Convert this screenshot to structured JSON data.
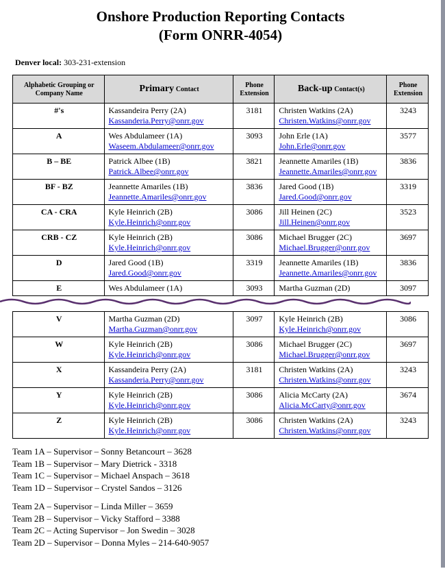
{
  "title_line1": "Onshore Production Reporting Contacts",
  "title_line2": "(Form ONRR-4054)",
  "denver_label": "Denver local:",
  "denver_value": "303-231-extension",
  "headers": {
    "group": "Alphabetic Grouping or Company Name",
    "company_word": "Company",
    "primary_big": "Primary",
    "primary_small": "Contact",
    "ext": "Phone Extension",
    "backup_big": "Back-up",
    "backup_small": "Contact(s)",
    "ext2": "Phone Extension"
  },
  "rows_top": [
    {
      "g": "#'s",
      "p_name": "Kassandeira Perry (2A)",
      "p_mail": "Kassanderia.Perry@onrr.gov",
      "p_ext": "3181",
      "b_name": "Christen Watkins (2A)",
      "b_mail": "Christen.Watkins@onrr.gov",
      "b_ext": "3243"
    },
    {
      "g": "A",
      "p_name": "Wes Abdulameer (1A)",
      "p_mail": "Waseem.Abdulameer@onrr.gov",
      "p_ext": "3093",
      "b_name": "John Erle (1A)",
      "b_mail": "John.Erle@onrr.gov",
      "b_ext": "3577"
    },
    {
      "g": "B – BE",
      "p_name": "Patrick Albee (1B)",
      "p_mail": "Patrick.Albee@onrr.gov",
      "p_ext": "3821",
      "b_name": "Jeannette Amariles (1B)",
      "b_mail": "Jeannette.Amariles@onrr.gov",
      "b_ext": "3836"
    },
    {
      "g": "BF - BZ",
      "p_name": "Jeannette Amariles (1B)",
      "p_mail": "Jeannette.Amariles@onrr.gov",
      "p_ext": "3836",
      "b_name": "Jared Good (1B)",
      "b_mail": "Jared.Good@onrr.gov",
      "b_ext": "3319"
    },
    {
      "g": "CA - CRA",
      "p_name": "Kyle Heinrich (2B)",
      "p_mail": "Kyle.Heinrich@onrr.gov",
      "p_ext": "3086",
      "b_name": "Jill Heinen (2C)",
      "b_mail": "Jill.Heinen@onrr.gov",
      "b_ext": "3523"
    },
    {
      "g": "CRB - CZ",
      "p_name": "Kyle Heinrich (2B)",
      "p_mail": "Kyle.Heinrich@onrr.gov",
      "p_ext": "3086",
      "b_name": "Michael Brugger (2C)",
      "b_mail": "Michael.Brugger@onrr.gov",
      "b_ext": "3697"
    },
    {
      "g": "D",
      "p_name": "Jared Good (1B)",
      "p_mail": "Jared.Good@onrr.gov",
      "p_ext": "3319",
      "b_name": "Jeannette Amariles (1B)",
      "b_mail": "Jeannette.Amariles@onrr.gov",
      "b_ext": "3836"
    }
  ],
  "clipped_row": {
    "g": "E",
    "p_name": "Wes Abdulameer (1A)",
    "p_ext": "3093",
    "b_name": "Martha Guzman (2D)",
    "b_ext": "3097"
  },
  "rows_bottom": [
    {
      "g": "V",
      "p_name": "Martha Guzman (2D)",
      "p_mail": "Martha.Guzman@onrr.gov",
      "p_ext": "3097",
      "b_name": "Kyle Heinrich (2B)",
      "b_mail": "Kyle.Heinrich@onrr.gov",
      "b_ext": "3086"
    },
    {
      "g": "W",
      "p_name": "Kyle Heinrich (2B)",
      "p_mail": "Kyle.Heinrich@onrr.gov",
      "p_ext": "3086",
      "b_name": "Michael Brugger (2C)",
      "b_mail": "Michael.Brugger@onrr.gov",
      "b_ext": "3697"
    },
    {
      "g": "X",
      "p_name": "Kassandeira Perry (2A)",
      "p_mail": "Kassanderia.Perry@onrr.gov",
      "p_ext": "3181",
      "b_name": "Christen Watkins (2A)",
      "b_mail": "Christen.Watkins@onrr.gov",
      "b_ext": "3243"
    },
    {
      "g": "Y",
      "p_name": "Kyle Heinrich (2B)",
      "p_mail": "Kyle.Heinrich@onrr.gov",
      "p_ext": "3086",
      "b_name": "Alicia McCarty (2A)",
      "b_mail": "Alicia.McCarty@onrr.gov",
      "b_ext": "3674"
    },
    {
      "g": "Z",
      "p_name": "Kyle Heinrich (2B)",
      "p_mail": "Kyle.Heinrich@onrr.gov",
      "p_ext": "3086",
      "b_name": "Christen Watkins (2A)",
      "b_mail": "Christen.Watkins@onrr.gov",
      "b_ext": "3243"
    }
  ],
  "teams1": [
    "Team 1A – Supervisor – Sonny Betancourt – 3628",
    "Team 1B – Supervisor – Mary Dietrick - 3318",
    "Team 1C – Supervisor – Michael Anspach – 3618",
    "Team 1D – Supervisor – Crystel Sandos – 3126"
  ],
  "teams2": [
    "Team 2A – Supervisor – Linda Miller – 3659",
    "Team 2B – Supervisor – Vicky Stafford – 3388",
    "Team 2C – Acting Supervisor – Jon Swedin – 3028",
    "Team 2D – Supervisor – Donna Myles – 214-640-9057"
  ]
}
